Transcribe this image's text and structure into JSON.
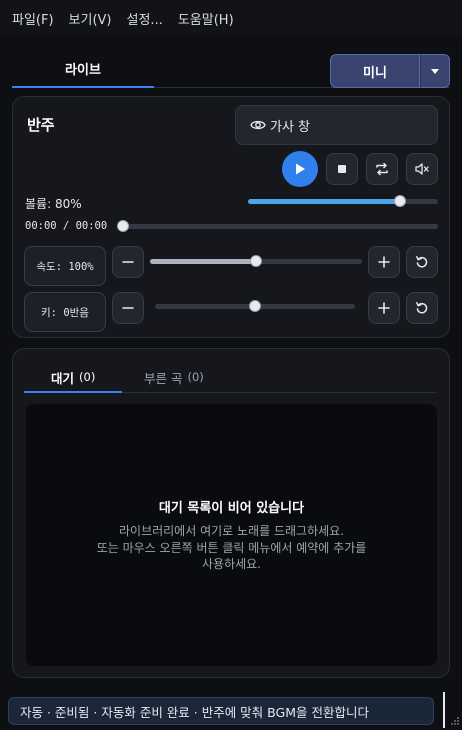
{
  "menu": {
    "items": [
      "파일(F)",
      "보기(V)",
      "설정...",
      "도움말(H)"
    ]
  },
  "tabs": {
    "live_label": "라이브",
    "mini_label": "미니"
  },
  "accompaniment": {
    "title": "반주",
    "lyrics_window_label": "가사 창",
    "volume_label": "볼륨: 80%",
    "volume_value": 0.8,
    "time_label": "00:00 / 00:00",
    "position_value": 0.0,
    "speed_label": "속도: 100%",
    "speed_value": 0.5,
    "key_label": "키: 0반음",
    "key_value": 0.5
  },
  "queue": {
    "tab_waiting_label": "대기",
    "tab_waiting_count": "(0)",
    "tab_played_label": "부른 곡",
    "tab_played_count": "(0)",
    "empty_title": "대기 목록이 비어 있습니다",
    "empty_line1": "라이브러리에서 여기로 노래를 드래그하세요.",
    "empty_line2": "또는 마우스 오른쪽 버튼 클릭 메뉴에서 예약에 추가를",
    "empty_line3": "사용하세요."
  },
  "status": {
    "text": "자동 · 준비됨 · 자동화 준비 완료 · 반주에 맞춰 BGM을 전환합니다"
  },
  "colors": {
    "accent": "#3b82f6",
    "play_button": "#2f80ed",
    "volume_fill": "#4aa8e8",
    "slider_fill": "#a9b3c2"
  }
}
